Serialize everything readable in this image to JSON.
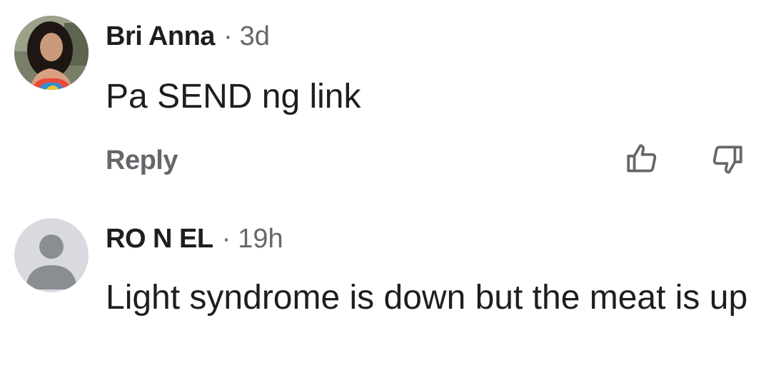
{
  "comments": [
    {
      "author": "Bri Anna",
      "separator": "·",
      "time": "3d",
      "text": "Pa SEND ng link",
      "reply_label": "Reply",
      "avatar": "photo-avatar"
    },
    {
      "author": "RO N EL",
      "separator": "·",
      "time": "19h",
      "text": "Light syndrome is down but the meat is up",
      "avatar": "default-avatar"
    }
  ],
  "icons": {
    "upvote": "thumbs-up-outline-icon",
    "downvote": "thumbs-down-outline-icon"
  },
  "colors": {
    "text_primary": "#1c1e21",
    "text_secondary": "#65676b",
    "default_avatar_bg": "#d8dadf",
    "default_avatar_fg": "#8a8d91"
  }
}
